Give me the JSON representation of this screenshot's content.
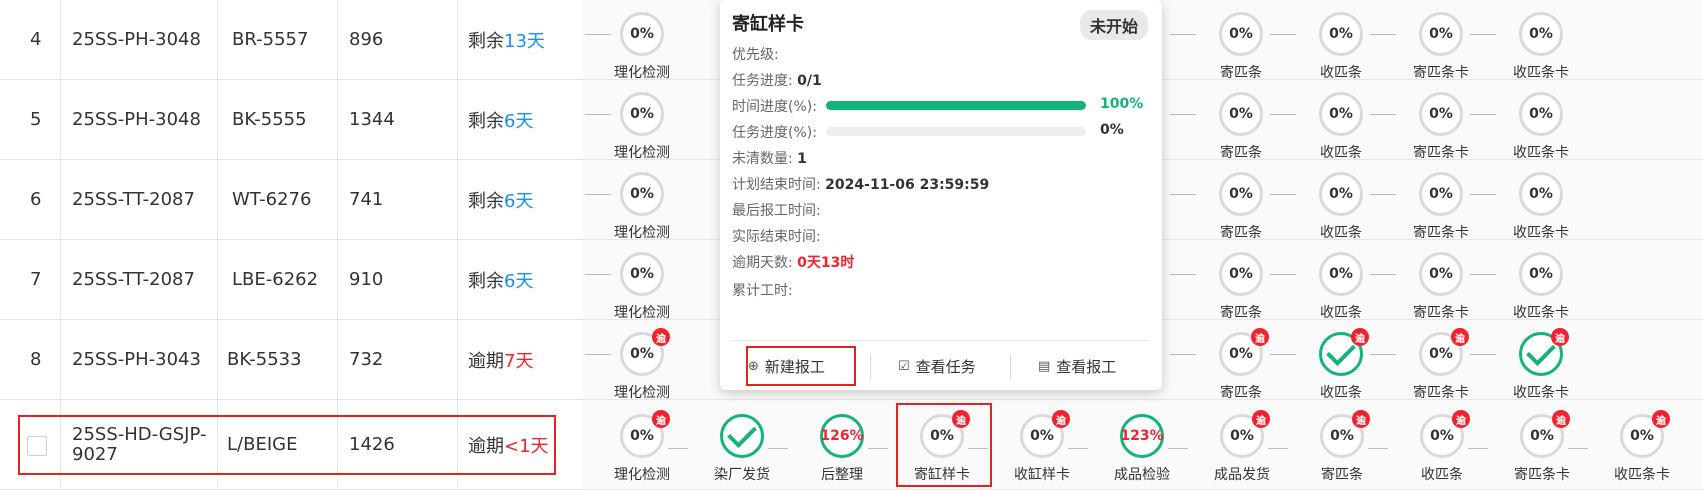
{
  "rows": [
    {
      "idx": "4",
      "style": "25SS-PH-3048",
      "color": "BR-5557",
      "qty": "896",
      "status_prefix": "剩余",
      "status_num": "13天",
      "status_type": "remain"
    },
    {
      "idx": "5",
      "style": "25SS-PH-3048",
      "color": "BK-5555",
      "qty": "1344",
      "status_prefix": "剩余",
      "status_num": "6天",
      "status_type": "remain"
    },
    {
      "idx": "6",
      "style": "25SS-TT-2087",
      "color": "WT-6276",
      "qty": "741",
      "status_prefix": "剩余",
      "status_num": "6天",
      "status_type": "remain"
    },
    {
      "idx": "7",
      "style": "25SS-TT-2087",
      "color": "LBE-6262",
      "qty": "910",
      "status_prefix": "剩余",
      "status_num": "6天",
      "status_type": "remain"
    },
    {
      "idx": "8",
      "style": "25SS-PH-3043",
      "color": "BK-5533",
      "qty": "732",
      "status_prefix": "逾期",
      "status_num": "7天",
      "status_type": "overdue"
    },
    {
      "idx": "",
      "style": "25SS-HD-GSJP-9027",
      "color": "L/BEIGE",
      "qty": "1426",
      "status_prefix": "逾期",
      "status_num": "<1天",
      "status_type": "overdue"
    }
  ],
  "steps_partial": [
    {
      "label": "理化检测",
      "pct": "0%"
    },
    {
      "label": "寄匹条",
      "pct": "0%"
    },
    {
      "label": "收匹条",
      "pct": "0%"
    },
    {
      "label": "寄匹条卡",
      "pct": "0%"
    },
    {
      "label": "收匹条卡",
      "pct": "0%"
    }
  ],
  "steps_full": [
    {
      "label": "理化检测",
      "pct": "0%",
      "state": "todo",
      "badge": true
    },
    {
      "label": "染厂发货",
      "pct": "",
      "state": "check",
      "badge": false
    },
    {
      "label": "后整理",
      "pct": "126%",
      "state": "over",
      "badge": false
    },
    {
      "label": "寄缸样卡",
      "pct": "0%",
      "state": "todo",
      "badge": true
    },
    {
      "label": "收缸样卡",
      "pct": "0%",
      "state": "todo",
      "badge": true
    },
    {
      "label": "成品检验",
      "pct": "123%",
      "state": "over",
      "badge": false
    },
    {
      "label": "成品发货",
      "pct": "0%",
      "state": "todo",
      "badge": true
    },
    {
      "label": "寄匹条",
      "pct": "0%",
      "state": "todo",
      "badge": true
    },
    {
      "label": "收匹条",
      "pct": "0%",
      "state": "todo",
      "badge": true
    },
    {
      "label": "寄匹条卡",
      "pct": "0%",
      "state": "todo",
      "badge": true
    },
    {
      "label": "收匹条卡",
      "pct": "0%",
      "state": "todo",
      "badge": true
    }
  ],
  "badge_text": "逾",
  "row8_hidden_labels": [
    "染厂发货",
    "成品检验",
    "成品发货",
    "寄缸样卡",
    "成品检验"
  ],
  "popover": {
    "title": "寄缸样卡",
    "status": "未开始",
    "priority_label": "优先级:",
    "task_progress_label": "任务进度:",
    "task_progress_value": "0/1",
    "time_progress_label": "时间进度(%):",
    "time_progress_pct": "100%",
    "time_progress_fraction": 1.0,
    "task_progress_pct_label": "任务进度(%):",
    "task_progress_pct": "0%",
    "task_progress_fraction": 0.0,
    "uncleared_label": "未清数量:",
    "uncleared_value": "1",
    "plan_end_label": "计划结束时间:",
    "plan_end_value": "2024-11-06 23:59:59",
    "last_report_label": "最后报工时间:",
    "actual_end_label": "实际结束时间:",
    "overdue_days_label": "逾期天数:",
    "overdue_days_value": "0天13时",
    "total_hours_label": "累计工时:",
    "btn_new_report": "新建报工",
    "btn_view_task": "查看任务",
    "btn_view_report": "查看报工"
  },
  "colors": {
    "green": "#13b47a",
    "red": "#f5222d",
    "blue": "#1890ff",
    "highlight": "#e02424"
  }
}
